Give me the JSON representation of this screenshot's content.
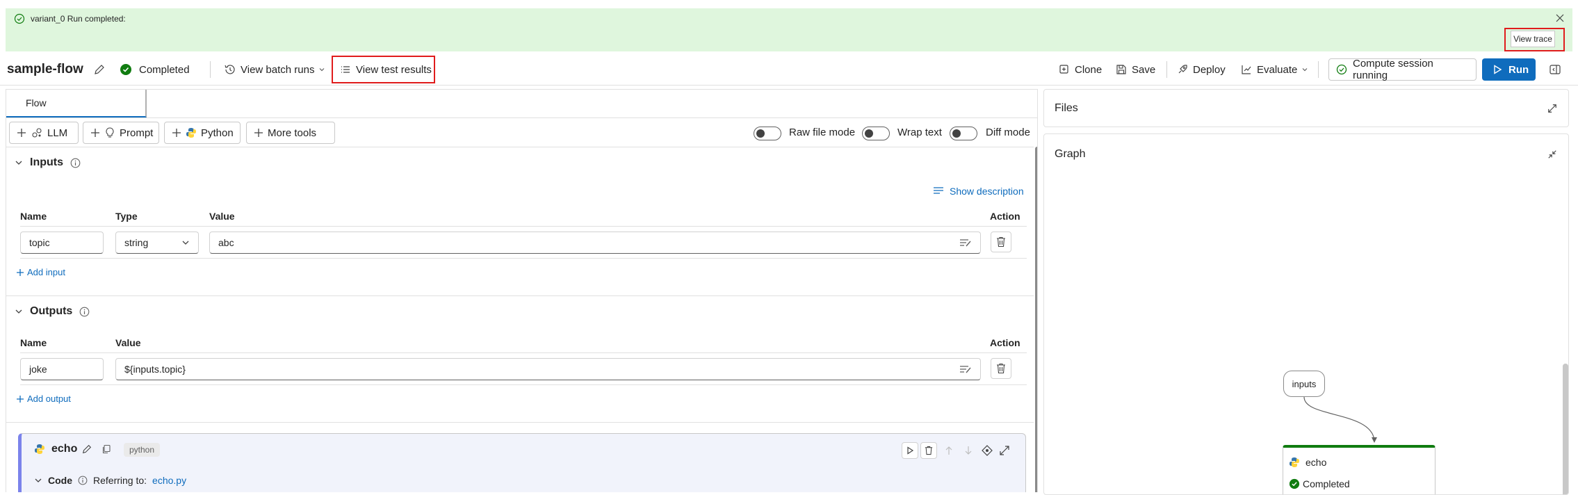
{
  "notification": {
    "message": "variant_0 Run completed:",
    "view_trace_label": "View trace"
  },
  "toolbar": {
    "flow_name": "sample-flow",
    "status": "Completed",
    "view_batch_runs": "View batch runs",
    "view_test_results": "View test results",
    "clone": "Clone",
    "save": "Save",
    "deploy": "Deploy",
    "evaluate": "Evaluate",
    "compute_session": "Compute session running",
    "run": "Run"
  },
  "tabs": {
    "flow": "Flow"
  },
  "tools": {
    "llm": "LLM",
    "prompt": "Prompt",
    "python": "Python",
    "more_tools": "More tools"
  },
  "toggles": {
    "raw_file_mode": "Raw file mode",
    "wrap_text": "Wrap text",
    "diff_mode": "Diff mode"
  },
  "inputs_section": {
    "title": "Inputs",
    "show_description": "Show description",
    "col_name": "Name",
    "col_type": "Type",
    "col_value": "Value",
    "col_action": "Action",
    "row": {
      "name": "topic",
      "type": "string",
      "value": "abc"
    },
    "add_input": "Add input"
  },
  "outputs_section": {
    "title": "Outputs",
    "col_name": "Name",
    "col_value": "Value",
    "col_action": "Action",
    "row": {
      "name": "joke",
      "value": "${inputs.topic}"
    },
    "add_output": "Add output"
  },
  "node": {
    "name": "echo",
    "badge": "python",
    "code_label": "Code",
    "referring_to": "Referring to:",
    "file": "echo.py"
  },
  "right": {
    "files_title": "Files",
    "graph_title": "Graph",
    "graph_inputs_node": "inputs",
    "graph_echo_node": "echo",
    "graph_echo_status": "Completed"
  },
  "colors": {
    "accent": "#0f6cbd",
    "success": "#107c10",
    "notification_bg": "#dff6dd",
    "highlight": "#e01c1c"
  }
}
